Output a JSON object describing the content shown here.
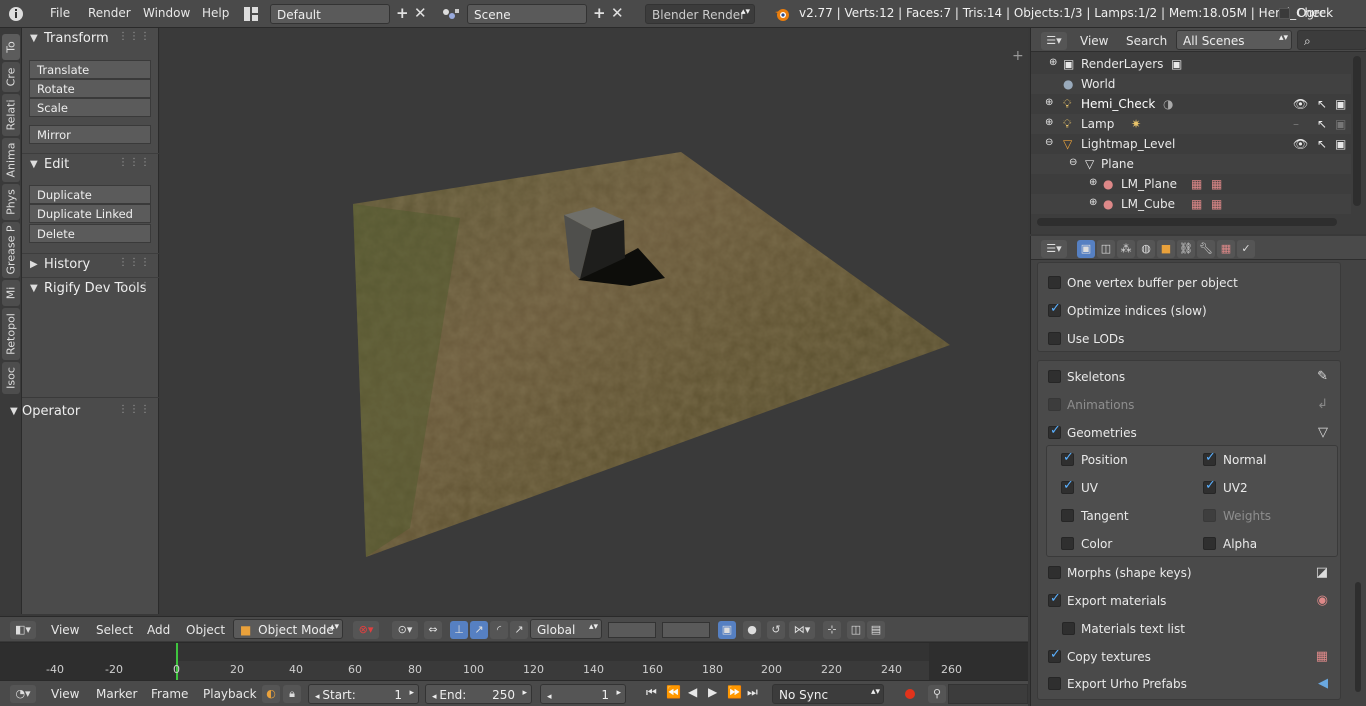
{
  "topbar": {
    "menus": [
      "File",
      "Render",
      "Window",
      "Help"
    ],
    "layout": "Default",
    "scene": "Scene",
    "engine": "Blender Render",
    "stats": "v2.77 | Verts:12 | Faces:7 | Tris:14 | Objects:1/3 | Lamps:1/2 | Mem:18.05M | Hemi_Check",
    "addon": "Ogre"
  },
  "tabs": [
    "To",
    "Cre",
    "Relati",
    "Anima",
    "Phys",
    "Grease P",
    "Mi",
    "Retopol",
    "Isoc"
  ],
  "toolshelf": {
    "transform": "Transform",
    "translate": "Translate",
    "rotate": "Rotate",
    "scale": "Scale",
    "mirror": "Mirror",
    "edit": "Edit",
    "duplicate": "Duplicate",
    "duplicate_linked": "Duplicate Linked",
    "delete": "Delete",
    "history": "History",
    "rigify": "Rigify Dev Tools",
    "operator": "Operator"
  },
  "viewheader": {
    "view": "View",
    "select": "Select",
    "add": "Add",
    "object": "Object",
    "mode": "Object Mode",
    "orientation": "Global"
  },
  "timeline": {
    "ticks": [
      "-40",
      "-20",
      "0",
      "20",
      "40",
      "60",
      "80",
      "100",
      "120",
      "140",
      "160",
      "180",
      "200",
      "220",
      "240",
      "260"
    ],
    "current_frame": 1,
    "view": "View",
    "marker": "Marker",
    "frame": "Frame",
    "playback": "Playback",
    "start_label": "Start:",
    "start": "1",
    "end_label": "End:",
    "end": "250",
    "current": "1",
    "sync": "No Sync"
  },
  "outliner": {
    "view": "View",
    "search": "Search",
    "scenes": "All Scenes",
    "items": [
      "RenderLayers",
      "World",
      "Hemi_Check",
      "Lamp",
      "Lightmap_Level",
      "Plane",
      "LM_Plane",
      "LM_Cube"
    ]
  },
  "properties": {
    "one_vertex": "One vertex buffer per object",
    "optimize": "Optimize indices (slow)",
    "lods": "Use LODs",
    "skeletons": "Skeletons",
    "animations": "Animations",
    "geometries": "Geometries",
    "position": "Position",
    "normal": "Normal",
    "uv": "UV",
    "uv2": "UV2",
    "tangent": "Tangent",
    "weights": "Weights",
    "color": "Color",
    "alpha": "Alpha",
    "morphs": "Morphs (shape keys)",
    "export_materials": "Export materials",
    "materials_text": "Materials text list",
    "copy_textures": "Copy textures",
    "export_prefabs": "Export Urho Prefabs"
  }
}
